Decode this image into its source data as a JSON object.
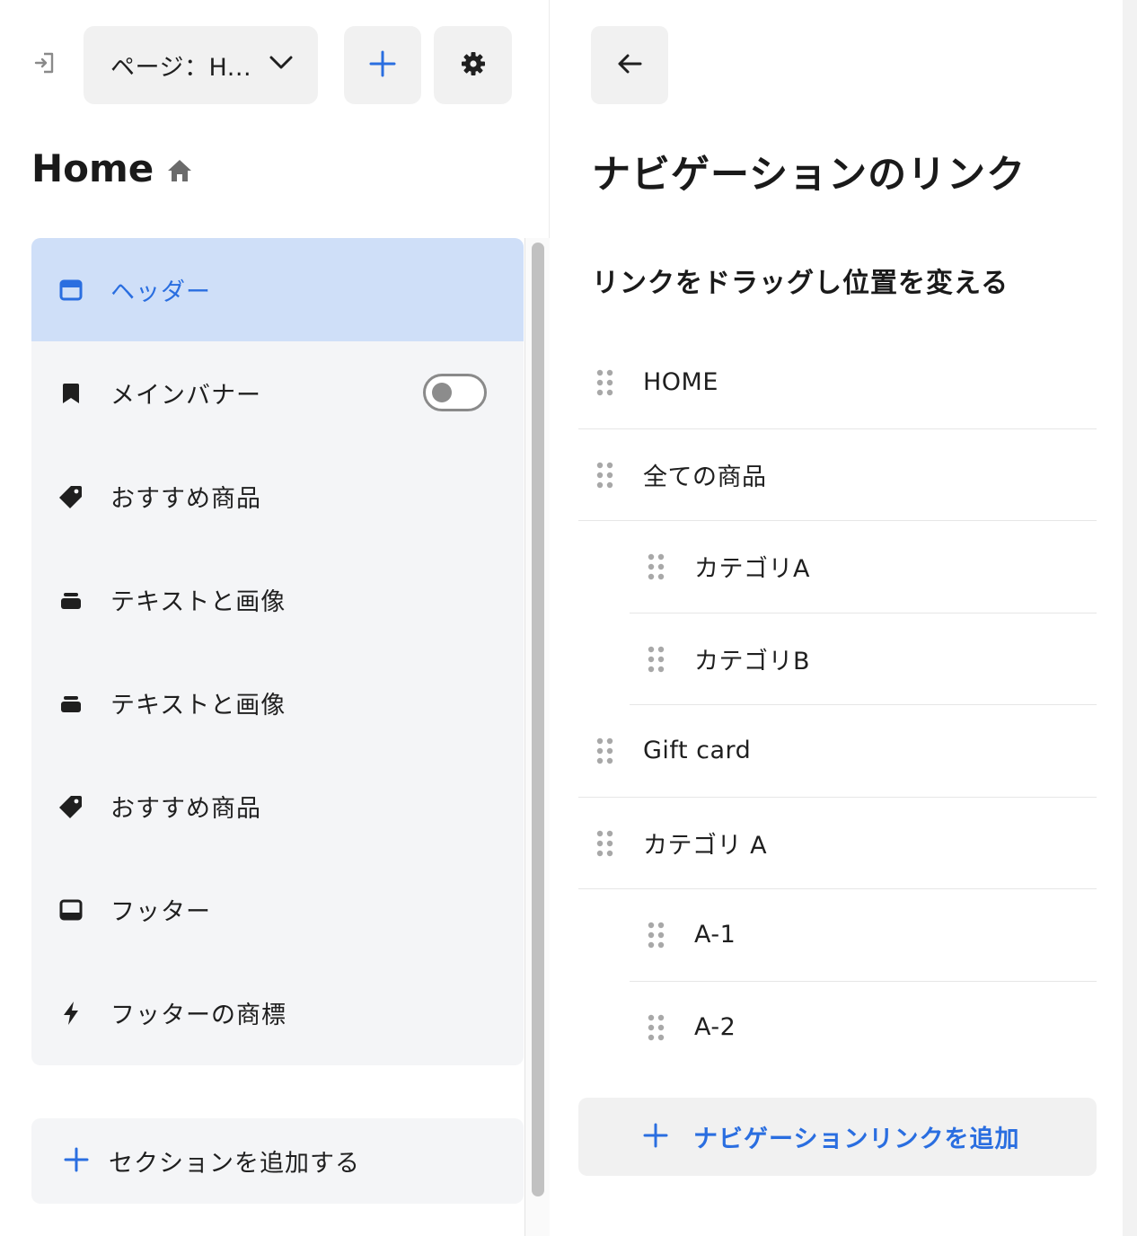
{
  "colors": {
    "accent": "#2a6ee0",
    "active_bg": "#cfdff8",
    "panel_bg": "#f4f5f7",
    "button_bg": "#f1f1f1"
  },
  "toolbar": {
    "exit_icon": "exit-icon",
    "page_select_label": "ページ：H...",
    "add_icon": "plus-icon",
    "settings_icon": "gear-icon"
  },
  "page": {
    "title": "Home",
    "title_icon": "home-icon"
  },
  "sections": [
    {
      "label": "ヘッダー",
      "icon": "header-layout-icon",
      "active": true
    },
    {
      "label": "メインバナー",
      "icon": "bookmark-icon",
      "toggle": false
    },
    {
      "label": "おすすめ商品",
      "icon": "tag-icon"
    },
    {
      "label": "テキストと画像",
      "icon": "image-text-icon"
    },
    {
      "label": "テキストと画像",
      "icon": "image-text-icon"
    },
    {
      "label": "おすすめ商品",
      "icon": "tag-icon"
    },
    {
      "label": "フッター",
      "icon": "footer-layout-icon"
    },
    {
      "label": "フッターの商標",
      "icon": "lightning-icon"
    }
  ],
  "add_section": {
    "label": "セクションを追加する",
    "icon": "plus-icon"
  },
  "nav_panel": {
    "back_icon": "arrow-left-icon",
    "title": "ナビゲーションのリンク",
    "subtitle": "リンクをドラッグし位置を変える",
    "links": [
      {
        "label": "HOME",
        "level": 0
      },
      {
        "label": "全ての商品",
        "level": 0
      },
      {
        "label": "カテゴリA",
        "level": 1
      },
      {
        "label": "カテゴリB",
        "level": 1
      },
      {
        "label": "Gift card",
        "level": 0
      },
      {
        "label": "カテゴリ A",
        "level": 0
      },
      {
        "label": "A-1",
        "level": 1
      },
      {
        "label": "A-2",
        "level": 1
      }
    ],
    "add_link_label": "ナビゲーションリンクを追加",
    "add_link_icon": "plus-icon"
  }
}
